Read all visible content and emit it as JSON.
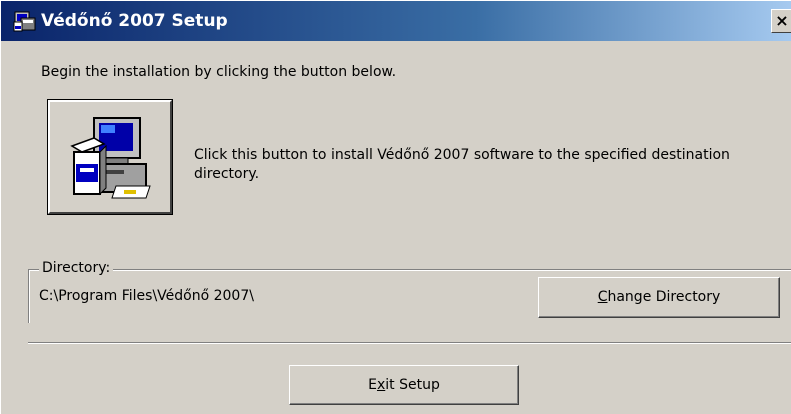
{
  "window": {
    "title": "Védőnő 2007 Setup",
    "close_glyph": "×"
  },
  "intro_text": "Begin the installation by clicking the button below.",
  "install": {
    "icon": "install-computer-icon",
    "description": "Click this button to install Védőnő 2007 software to the specified destination directory."
  },
  "directory": {
    "legend": "Directory:",
    "path": "C:\\Program Files\\Védőnő 2007\\",
    "change_button": {
      "mnemonic": "C",
      "rest": "hange Directory"
    }
  },
  "exit_button": {
    "before": "E",
    "mnemonic": "x",
    "after": "it Setup"
  },
  "colors": {
    "window_bg": "#d4d0c8",
    "title_start": "#0a246a",
    "title_end": "#a6caf0"
  }
}
